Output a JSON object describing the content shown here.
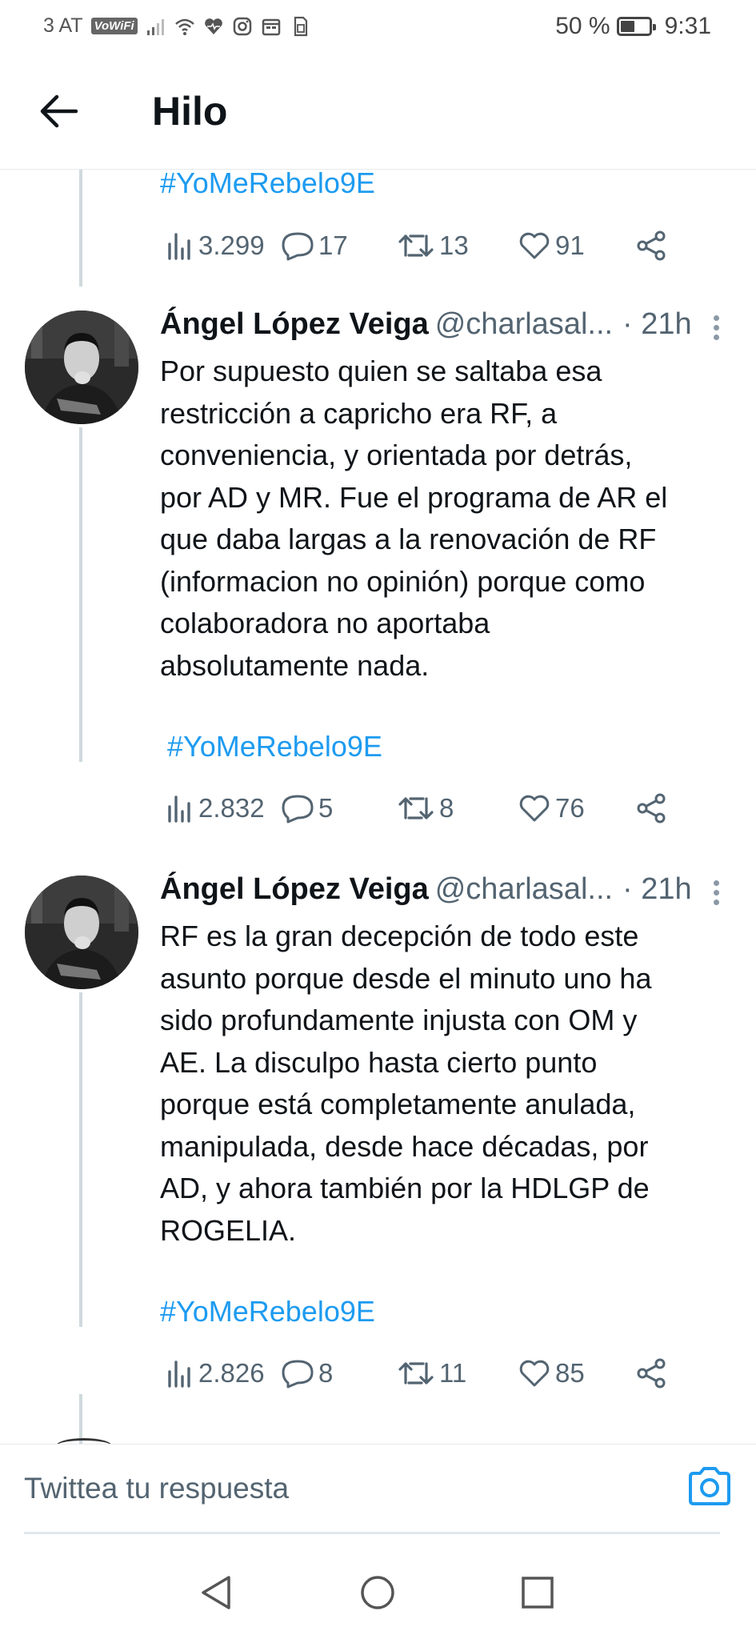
{
  "status_bar": {
    "carrier": "3 AT",
    "vowifi": "VoWiFi",
    "battery": "50 %",
    "time": "9:31"
  },
  "header": {
    "title": "Hilo"
  },
  "top_tweet_partial": {
    "hashtag": "#YoMeRebelo9E",
    "views": "3.299",
    "replies": "17",
    "retweets": "13",
    "likes": "91"
  },
  "tweets": [
    {
      "name": "Ángel López Veiga",
      "handle": "@charlasal...",
      "time": "· 21h",
      "lines": [
        "Por supuesto quien se saltaba esa",
        "restricción a capricho era RF, a",
        "conveniencia, y orientada por detrás,",
        "por AD y MR. Fue el programa de AR el",
        "que daba largas a la renovación de RF",
        "(informacion no opinión) porque como",
        "colaboradora no aportaba",
        "absolutamente nada."
      ],
      "hashtag": "#YoMeRebelo9E",
      "views": "2.832",
      "replies": "5",
      "retweets": "8",
      "likes": "76"
    },
    {
      "name": "Ángel López Veiga",
      "handle": "@charlasal...",
      "time": "· 21h",
      "lines": [
        "RF es la gran decepción de todo este",
        "asunto porque desde el minuto uno ha",
        "sido profundamente injusta con OM y",
        "AE. La disculpo hasta cierto punto",
        "porque está completamente anulada,",
        "manipulada, desde hace décadas, por",
        "AD, y ahora también por la HDLGP de",
        "ROGELIA."
      ],
      "hashtag": "#YoMeRebelo9E",
      "views": "2.826",
      "replies": "8",
      "retweets": "11",
      "likes": "85"
    }
  ],
  "reply": {
    "placeholder": "Twittea tu respuesta"
  },
  "colors": {
    "link": "#1d9bf0",
    "secondary_text": "#536471",
    "thread_line": "#cfd9de"
  }
}
